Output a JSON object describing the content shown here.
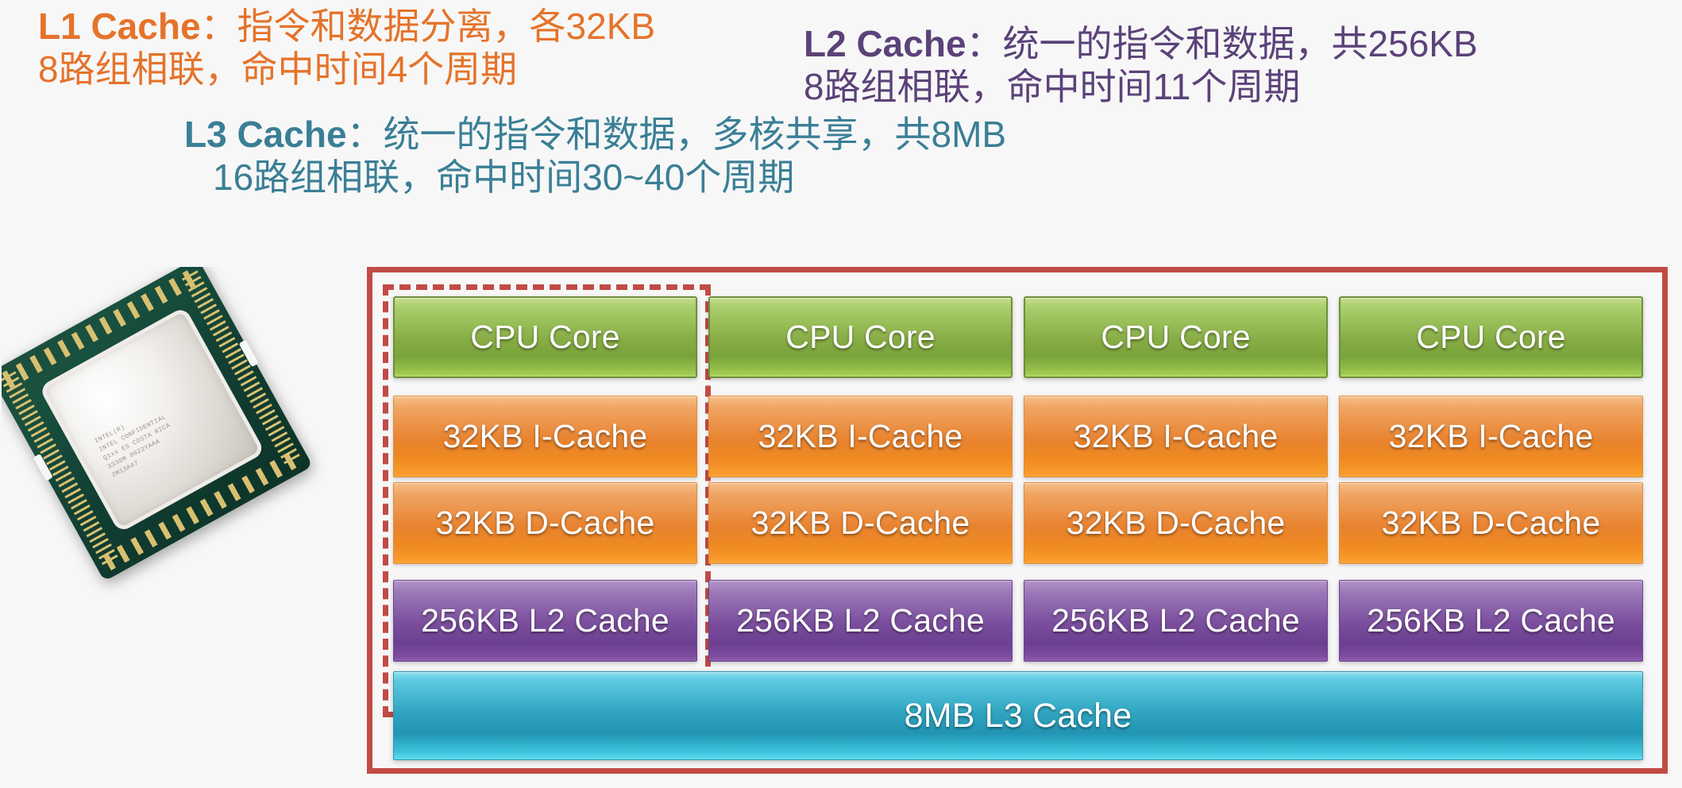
{
  "notes": {
    "l1": {
      "lead": "L1 Cache",
      "line1_rest": "：指令和数据分离，各32KB",
      "line2": "8路组相联，命中时间4个周期",
      "color": "#E5732A"
    },
    "l2": {
      "lead": "L2 Cache",
      "line1_rest": "：统一的指令和数据，共256KB",
      "line2": "8路组相联，命中时间11个周期",
      "color": "#5B4279"
    },
    "l3": {
      "lead": "L3 Cache",
      "line1_rest": "：统一的指令和数据，多核共享，共8MB",
      "line2": "16路组相联，命中时间30~40个周期",
      "color": "#3A7F96"
    }
  },
  "photo": {
    "name": "intel-cpu-photo",
    "ihs_text": "INTEL(R)\nINTEL CONFIDENTIAL\nQ1xx ES COSTA RICA\n3330M 8022YAAA\n2M13A47"
  },
  "diagram": {
    "frame_color": "#C14B45",
    "highlight_color": "#C14B45",
    "columns": [
      {
        "core": "CPU Core",
        "icache": "32KB I-Cache",
        "dcache": "32KB D-Cache",
        "l2": "256KB L2 Cache"
      },
      {
        "core": "CPU Core",
        "icache": "32KB I-Cache",
        "dcache": "32KB D-Cache",
        "l2": "256KB L2 Cache"
      },
      {
        "core": "CPU Core",
        "icache": "32KB I-Cache",
        "dcache": "32KB D-Cache",
        "l2": "256KB L2 Cache"
      },
      {
        "core": "CPU Core",
        "icache": "32KB I-Cache",
        "dcache": "32KB D-Cache",
        "l2": "256KB L2 Cache"
      }
    ],
    "l3": "8MB L3 Cache",
    "colors": {
      "core": "#86ab44",
      "cache_l1": "#e8822e",
      "cache_l2": "#7b4f9e",
      "cache_l3": "#2ea3bf"
    }
  }
}
